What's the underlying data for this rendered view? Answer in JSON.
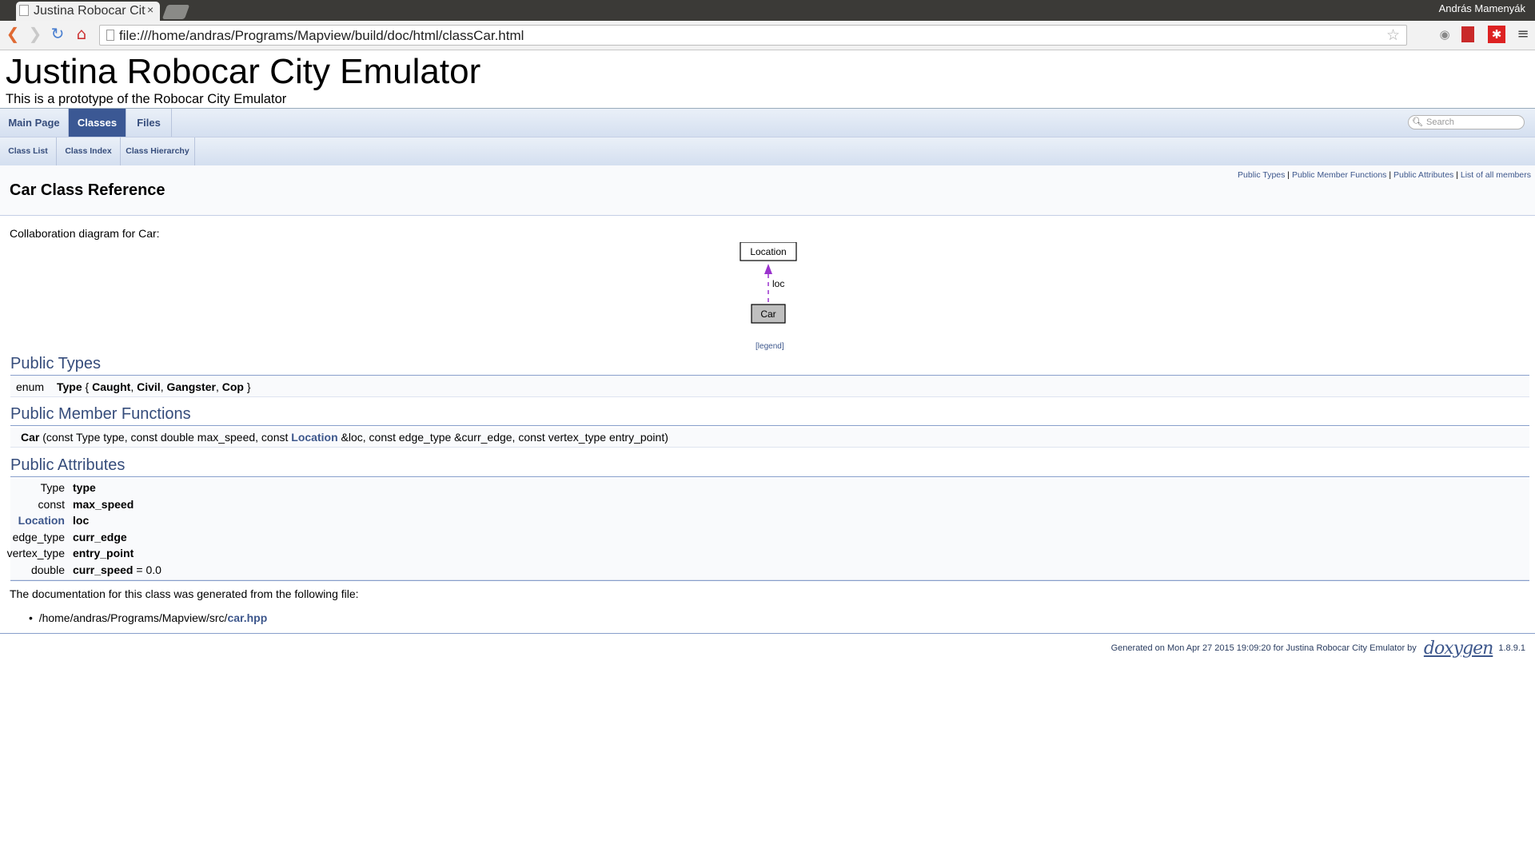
{
  "browser": {
    "tab_title": "Justina Robocar City Emulator",
    "tab_close": "×",
    "user": "András Mamenyák",
    "url": "file:///home/andras/Programs/Mapview/build/doc/html/classCar.html"
  },
  "header": {
    "project_name": "Justina Robocar City Emulator",
    "project_brief": "This is a prototype of the Robocar City Emulator"
  },
  "nav": {
    "tabs": [
      "Main Page",
      "Classes",
      "Files"
    ],
    "subtabs": [
      "Class List",
      "Class Index",
      "Class Hierarchy"
    ],
    "search_placeholder": "Search"
  },
  "summary_links": [
    "Public Types",
    "Public Member Functions",
    "Public Attributes",
    "List of all members"
  ],
  "page_title": "Car Class Reference",
  "collab": {
    "label": "Collaboration diagram for Car:",
    "node_top": "Location",
    "node_bottom": "Car",
    "edge_label": "loc",
    "legend": "legend"
  },
  "public_types": {
    "heading": "Public Types",
    "enum_kw": "enum",
    "type_name": "Type",
    "values": [
      "Caught",
      "Civil",
      "Gangster",
      "Cop"
    ]
  },
  "public_functions": {
    "heading": "Public Member Functions",
    "name": "Car",
    "args_pre": "(const Type type, const double max_speed, const ",
    "link": "Location",
    "args_post": " &loc, const edge_type &curr_edge, const vertex_type entry_point)"
  },
  "public_attributes": {
    "heading": "Public Attributes",
    "rows": [
      {
        "type": "Type",
        "name": "type",
        "extra": ""
      },
      {
        "type": "const double",
        "name": "max_speed",
        "extra": ""
      },
      {
        "type": "Location",
        "name": "loc",
        "extra": ""
      },
      {
        "type": "edge_type",
        "name": "curr_edge",
        "extra": ""
      },
      {
        "type": "vertex_type",
        "name": "entry_point",
        "extra": ""
      },
      {
        "type": "double",
        "name": "curr_speed",
        "extra": " = 0.0"
      }
    ]
  },
  "generated_from": {
    "text": "The documentation for this class was generated from the following file:",
    "path": "/home/andras/Programs/Mapview/src/",
    "file": "car.hpp"
  },
  "footer": {
    "text": "Generated on Mon Apr 27 2015 19:09:20 for Justina Robocar City Emulator by",
    "logo": "doxygen",
    "version": "1.8.9.1"
  }
}
